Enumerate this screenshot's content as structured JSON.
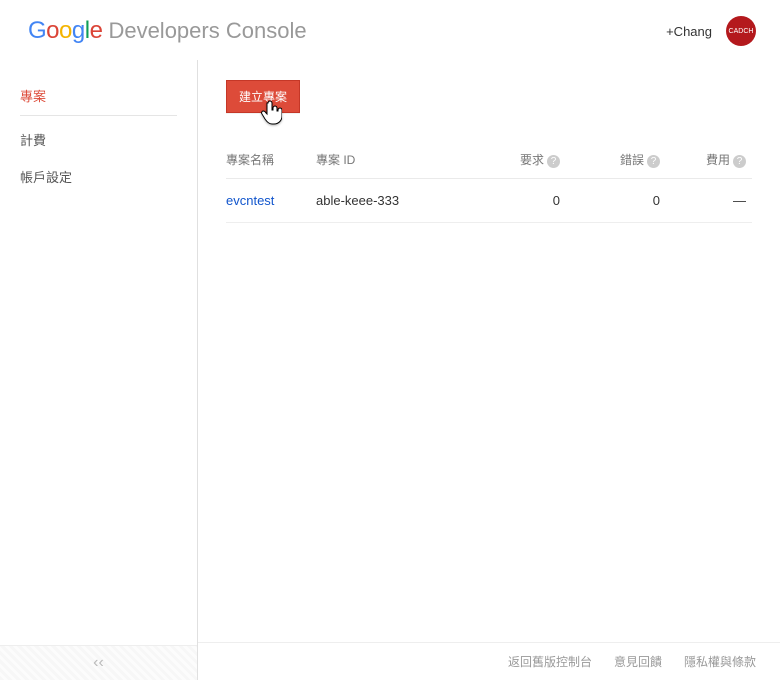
{
  "header": {
    "logo_letters": [
      "G",
      "o",
      "o",
      "g",
      "l",
      "e"
    ],
    "console_title": "Developers Console",
    "user_name": "+Chang",
    "avatar_text": "CADCH"
  },
  "sidebar": {
    "items": [
      {
        "label": "專案",
        "active": true
      },
      {
        "label": "計費",
        "active": false
      },
      {
        "label": "帳戶設定",
        "active": false
      }
    ],
    "collapse_glyph": "‹‹"
  },
  "main": {
    "create_button_label": "建立專案",
    "table": {
      "columns": {
        "name": "專案名稱",
        "id": "專案 ID",
        "requests": "要求",
        "errors": "錯誤",
        "cost": "費用"
      },
      "help_glyph": "?",
      "rows": [
        {
          "name": "evcntest",
          "id": "able-keee-333",
          "requests": "0",
          "errors": "0",
          "cost": "—"
        }
      ]
    }
  },
  "footer": {
    "links": [
      "返回舊版控制台",
      "意見回饋",
      "隱私權與條款"
    ]
  }
}
